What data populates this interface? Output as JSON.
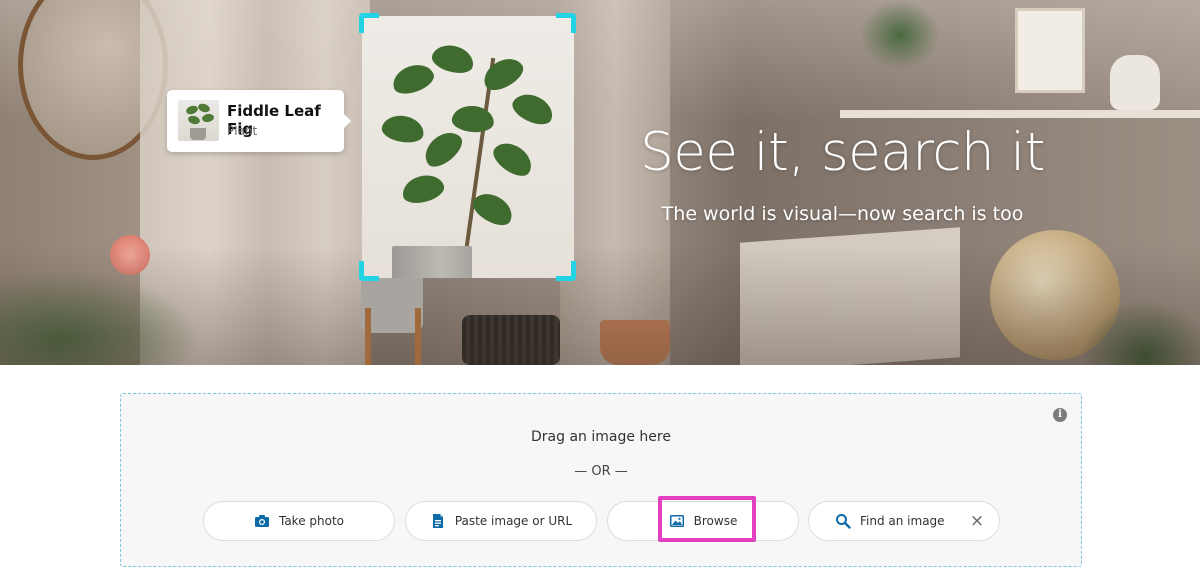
{
  "hero": {
    "title": "See it, search it",
    "subtitle": "The world is visual—now search is too",
    "detected_object": {
      "name": "Fiddle Leaf Fig",
      "category": "Plant"
    },
    "selection_color": "#22d3e6"
  },
  "dropzone": {
    "drag_text": "Drag an image here",
    "or_text": "— OR —",
    "info_icon": "info-icon",
    "border_color": "#7bc8dc",
    "buttons": {
      "take_photo": {
        "label": "Take photo",
        "icon": "camera-icon"
      },
      "paste": {
        "label": "Paste image or URL",
        "icon": "document-icon"
      },
      "browse": {
        "label": "Browse",
        "icon": "image-icon"
      },
      "find": {
        "label": "Find an image",
        "icon": "search-icon",
        "clear_icon": "close-icon"
      }
    },
    "icon_color": "#0f6aa8",
    "highlight_color": "#e33fc1"
  }
}
